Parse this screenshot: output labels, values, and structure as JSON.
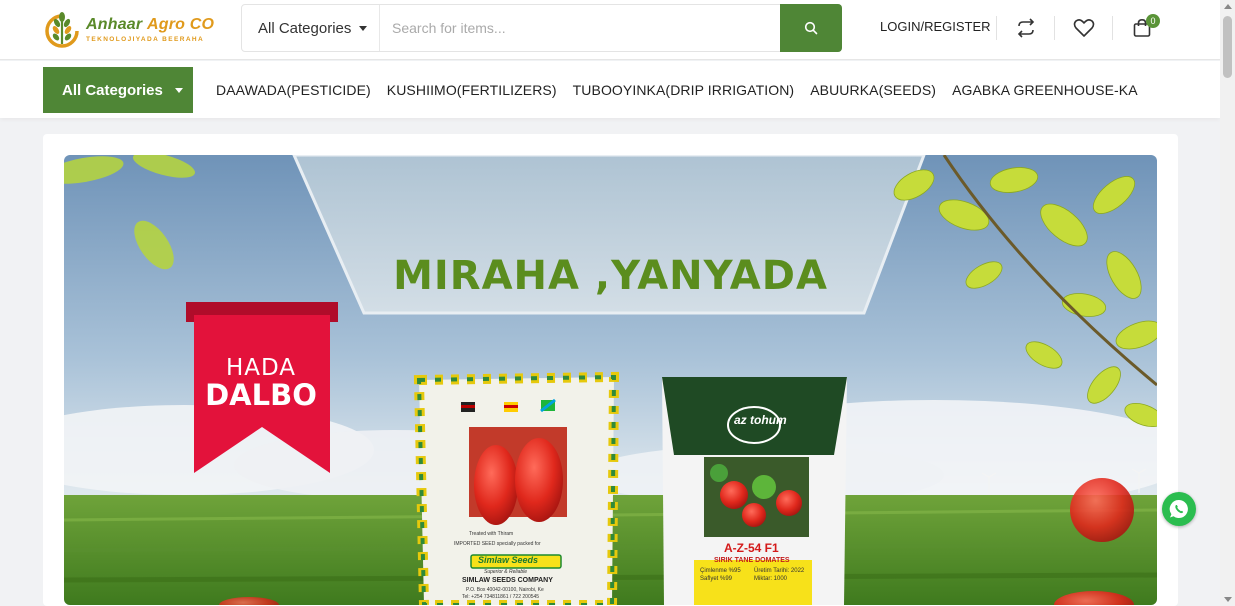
{
  "brand": {
    "name_part1": "Anhaar ",
    "name_part2": "Agro CO",
    "tagline": "TEKNOLOJIYADA BEERAHA",
    "green": "#5a8a2a",
    "orange": "#e09a1c"
  },
  "search": {
    "category_label": "All Categories",
    "placeholder": "Search for items...",
    "button_icon": "search-icon"
  },
  "header": {
    "login_label": "LOGIN/REGISTER",
    "compare_icon": "compare-arrows-icon",
    "wishlist_icon": "heart-icon",
    "cart_icon": "shopping-bag-icon",
    "cart_count": "0"
  },
  "nav": {
    "all_categories_label": "All Categories",
    "links": [
      "DAAWADA(PESTICIDE)",
      "KUSHIIMO(FERTILIZERS)",
      "TUBOOYINKA(DRIP IRRIGATION)",
      "ABUURKA(SEEDS)",
      "AGABKA GREENHOUSE-KA"
    ]
  },
  "banner": {
    "title": "MIRAHA ,YANYADA",
    "ribbon_line1": "HADA",
    "ribbon_line2": "DALBO",
    "packet1": {
      "brand": "Simlaw Seeds",
      "sub": "Superior & Reliable",
      "company": "SIMLAW SEEDS COMPANY",
      "address": "P.O. Box 40042-00100, Nairobi, Ke",
      "phone": "Tel: +254 734811861 / 722 200545",
      "treated": "Treated with Thiram",
      "imported": "IMPORTED SEED specially packed for"
    },
    "packet2": {
      "logo": "az tohum",
      "variety": "A-Z-54 F1",
      "desc": "SIRIK TANE DOMATES",
      "line1": "Çimlenme %95",
      "line2": "Saflyet %99",
      "line3": "Üretim Tarihi: 2022",
      "line4": "Miktar: 1000"
    },
    "accent_green": "#5b8d1e",
    "ribbon_red": "#e3123b"
  },
  "whatsapp_icon": "whatsapp-icon"
}
